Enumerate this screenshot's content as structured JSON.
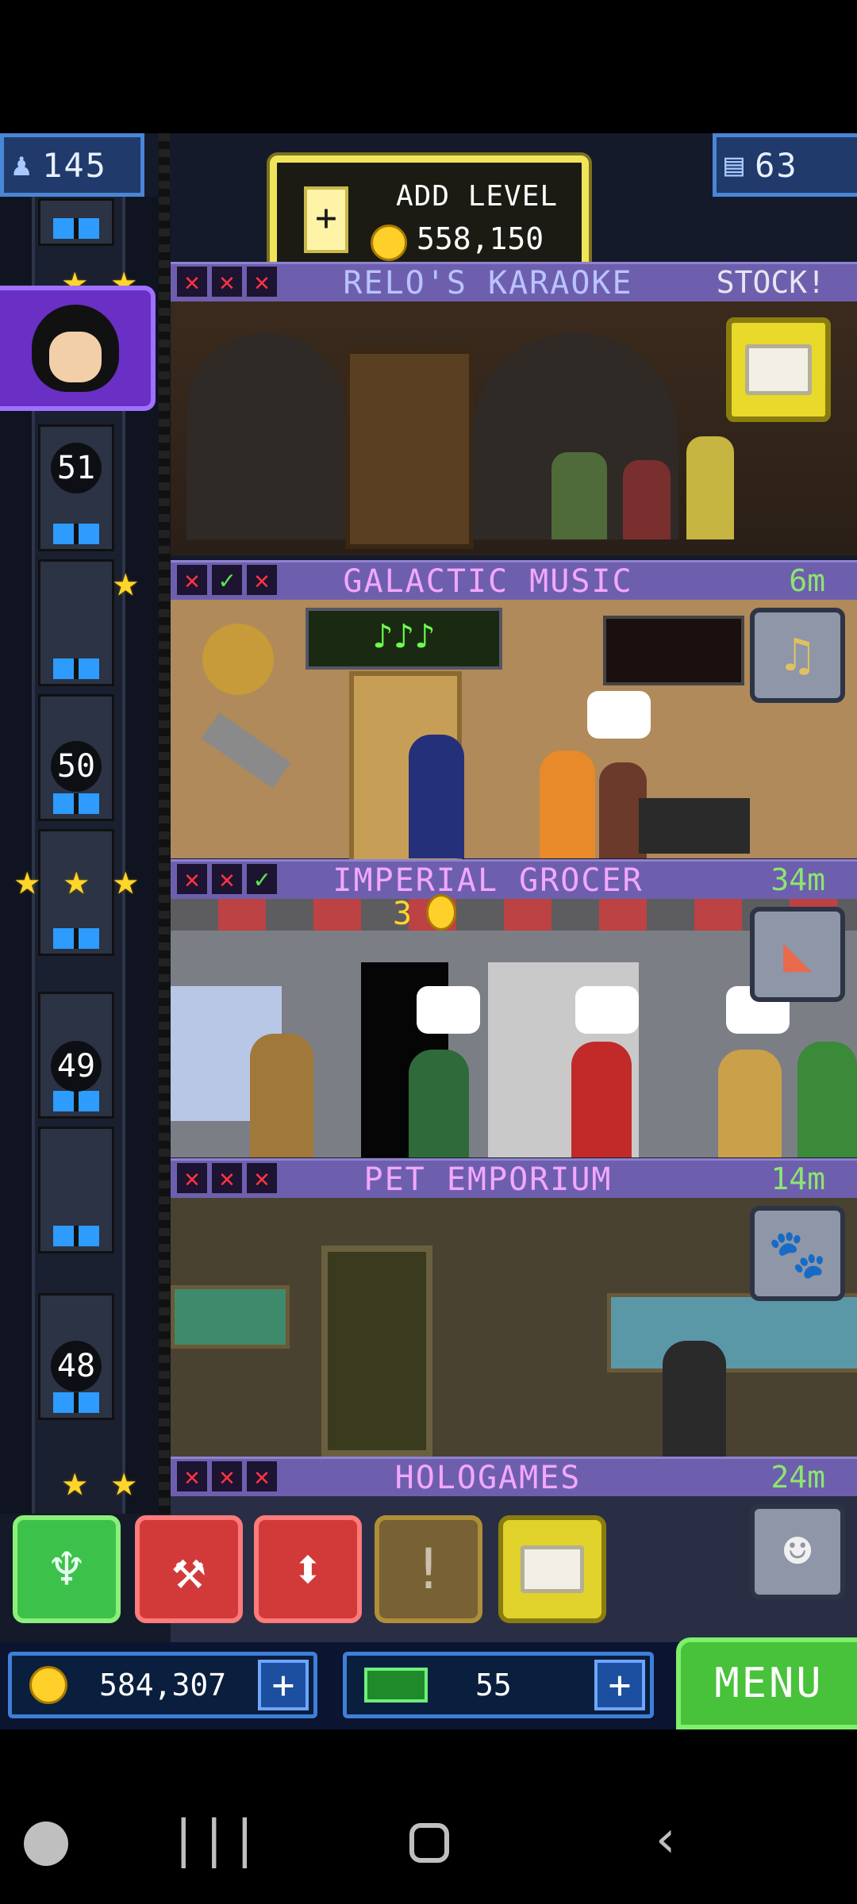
{
  "top": {
    "population": "145",
    "floors": "63",
    "add_level_label": "ADD LEVEL",
    "add_level_cost": "558,150"
  },
  "elevator": {
    "floor_numbers": [
      "51",
      "50",
      "49",
      "48"
    ]
  },
  "floors": [
    {
      "name": "RELO'S KARAOKE",
      "time": "STOCK!",
      "marks": [
        "x",
        "x",
        "x"
      ],
      "stock_item": "box-icon"
    },
    {
      "name": "GALACTIC MUSIC",
      "time": "6m",
      "marks": [
        "x",
        "ok",
        "x"
      ],
      "stock_item": "guitar-icon"
    },
    {
      "name": "IMPERIAL GROCER",
      "time": "34m",
      "marks": [
        "x",
        "x",
        "ok"
      ],
      "stock_item": "cake-icon"
    },
    {
      "name": "PET EMPORIUM",
      "time": "14m",
      "marks": [
        "x",
        "x",
        "x"
      ],
      "stock_item": "pet-icon"
    },
    {
      "name": "HOLOGAMES",
      "time": "24m",
      "marks": [
        "x",
        "x",
        "x"
      ],
      "stock_item": "holo-icon"
    }
  ],
  "room_details": {
    "grocer_counter": "3",
    "music_display": "♪♪♪"
  },
  "mark_glyphs": {
    "x": "✕",
    "ok": "✓"
  },
  "toolbar": {
    "buttons": [
      "vip-icon",
      "build-hammer-icon",
      "elevator-icon",
      "alert-icon",
      "stock-box-icon"
    ]
  },
  "wallet": {
    "coins": "584,307",
    "bux": "55"
  },
  "menu_label": "MENU",
  "colors": {
    "floor_bar": "#6e5fae",
    "floor_name": "#f3a7ff",
    "time_green": "#8ce66e",
    "menu_green": "#47c23a",
    "star": "#ffd52a"
  }
}
